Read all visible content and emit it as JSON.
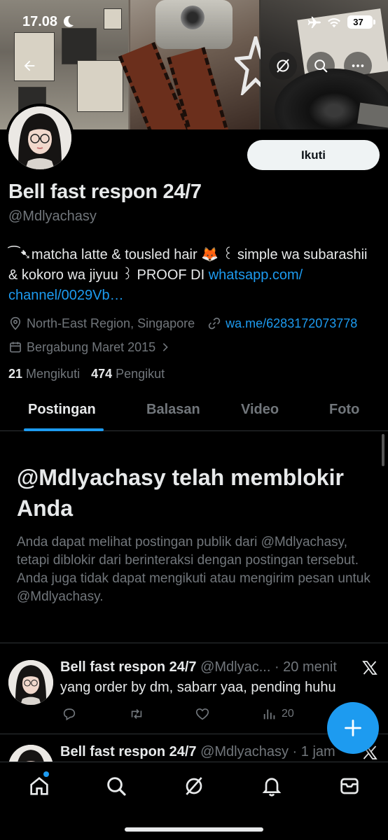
{
  "status_bar": {
    "time": "17.08",
    "battery": "37"
  },
  "profile": {
    "name": "Bell fast respon 24/7",
    "handle": "@Mdlyachasy",
    "follow_label": "Ikuti",
    "bio_line1": "⁀➷matcha latte & tousled hair 🦊 ꒰ simple wa subarashii",
    "bio_line2_text": "& kokoro wa jiyuu ꒱ PROOF DI ",
    "bio_link_part1": "whatsapp.com/",
    "bio_link_part2": "channel/0029Vb…",
    "location": "North-East Region, Singapore",
    "website": "wa.me/6283172073778",
    "joined": "Bergabung Maret 2015",
    "following_count": "21",
    "following_label": "Mengikuti",
    "followers_count": "474",
    "followers_label": "Pengikut"
  },
  "tabs": [
    {
      "label": "Postingan"
    },
    {
      "label": "Balasan"
    },
    {
      "label": "Video"
    },
    {
      "label": "Foto"
    }
  ],
  "blocked": {
    "title": "@Mdlyachasy telah memblokir Anda",
    "text": "Anda dapat melihat postingan publik dari @Mdlyachasy, tetapi diblokir dari berinteraksi dengan postingan tersebut. Anda juga tidak dapat mengikuti atau mengirim pesan untuk @Mdlyachasy."
  },
  "posts": [
    {
      "name": "Bell fast respon 24/7",
      "meta": " @Mdlyac... · 20 menit",
      "text": "yang order by dm, sabarr yaa, pending huhu",
      "views": "20"
    },
    {
      "name": "Bell fast respon 24/7",
      "meta": " @Mdlyachasy · 1 jam"
    }
  ],
  "colors": {
    "accent": "#1d9bf0",
    "background": "#000000",
    "secondary_text": "#71767b"
  },
  "icons": [
    "back-arrow-icon",
    "grok-icon",
    "search-icon",
    "more-icon",
    "location-icon",
    "link-icon",
    "calendar-icon",
    "x-logo-icon",
    "reply-icon",
    "repost-icon",
    "like-icon",
    "views-icon",
    "plus-icon",
    "home-icon",
    "explore-icon",
    "notifications-icon",
    "messages-icon"
  ]
}
